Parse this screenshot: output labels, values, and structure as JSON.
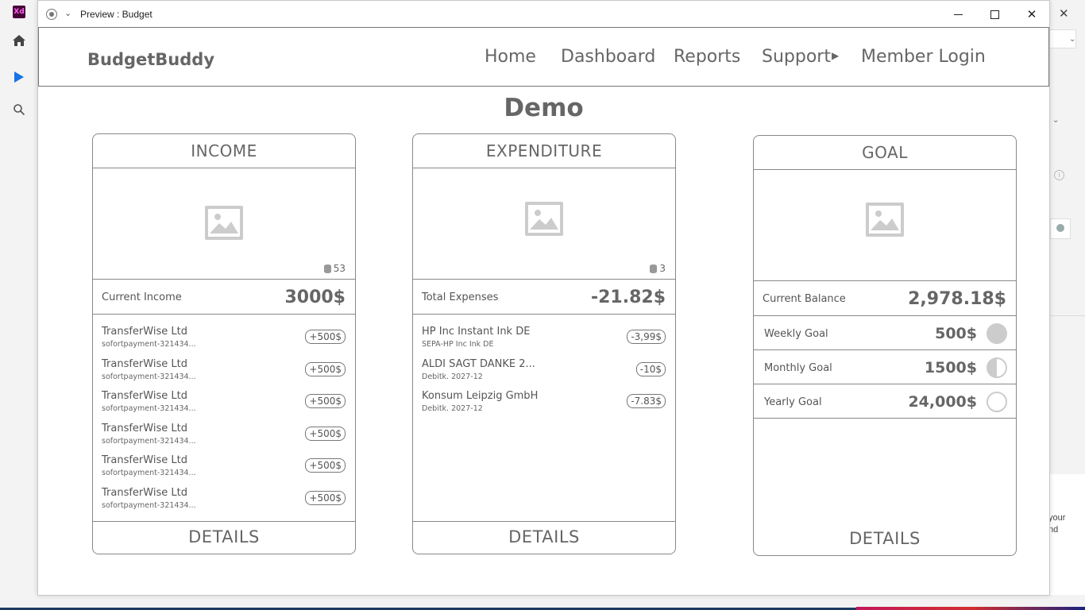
{
  "app": {
    "logo_text": "Xd",
    "right_panel_text_1": "your",
    "right_panel_text_2": "nd"
  },
  "window": {
    "title": "Preview : Budget"
  },
  "site": {
    "brand": "BudgetBuddy",
    "nav": {
      "home": "Home",
      "dashboard": "Dashboard",
      "reports": "Reports",
      "support": "Support",
      "member_login": "Member Login"
    },
    "page_title": "Demo"
  },
  "income": {
    "title": "INCOME",
    "count": "53",
    "total_label": "Current Income",
    "total_value": "3000$",
    "transactions": [
      {
        "name": "TransferWise Ltd",
        "sub": "sofortpayment-321434...",
        "amount": "+500$"
      },
      {
        "name": "TransferWise Ltd",
        "sub": "sofortpayment-321434...",
        "amount": "+500$"
      },
      {
        "name": "TransferWise Ltd",
        "sub": "sofortpayment-321434...",
        "amount": "+500$"
      },
      {
        "name": "TransferWise Ltd",
        "sub": "sofortpayment-321434...",
        "amount": "+500$"
      },
      {
        "name": "TransferWise Ltd",
        "sub": "sofortpayment-321434...",
        "amount": "+500$"
      },
      {
        "name": "TransferWise Ltd",
        "sub": "sofortpayment-321434...",
        "amount": "+500$"
      }
    ],
    "details": "DETAILS"
  },
  "expenditure": {
    "title": "EXPENDITURE",
    "count": "3",
    "total_label": "Total Expenses",
    "total_value": "-21.82$",
    "transactions": [
      {
        "name": "HP Inc Instant Ink DE",
        "sub": "SEPA-HP Inc Ink DE",
        "amount": "-3,99$"
      },
      {
        "name": "ALDI SAGT DANKE 2...",
        "sub": "Debitk. 2027-12",
        "amount": "-10$"
      },
      {
        "name": "Konsum Leipzig GmbH",
        "sub": "Debitk. 2027-12",
        "amount": "-7.83$"
      }
    ],
    "details": "DETAILS"
  },
  "goal": {
    "title": "GOAL",
    "balance_label": "Current Balance",
    "balance_value": "2,978.18$",
    "goals": [
      {
        "label": "Weekly Goal",
        "value": "500$",
        "progress": 1.0
      },
      {
        "label": "Monthly Goal",
        "value": "1500$",
        "progress": 0.5
      },
      {
        "label": "Yearly Goal",
        "value": "24,000$",
        "progress": 0.0
      }
    ],
    "details": "DETAILS"
  }
}
